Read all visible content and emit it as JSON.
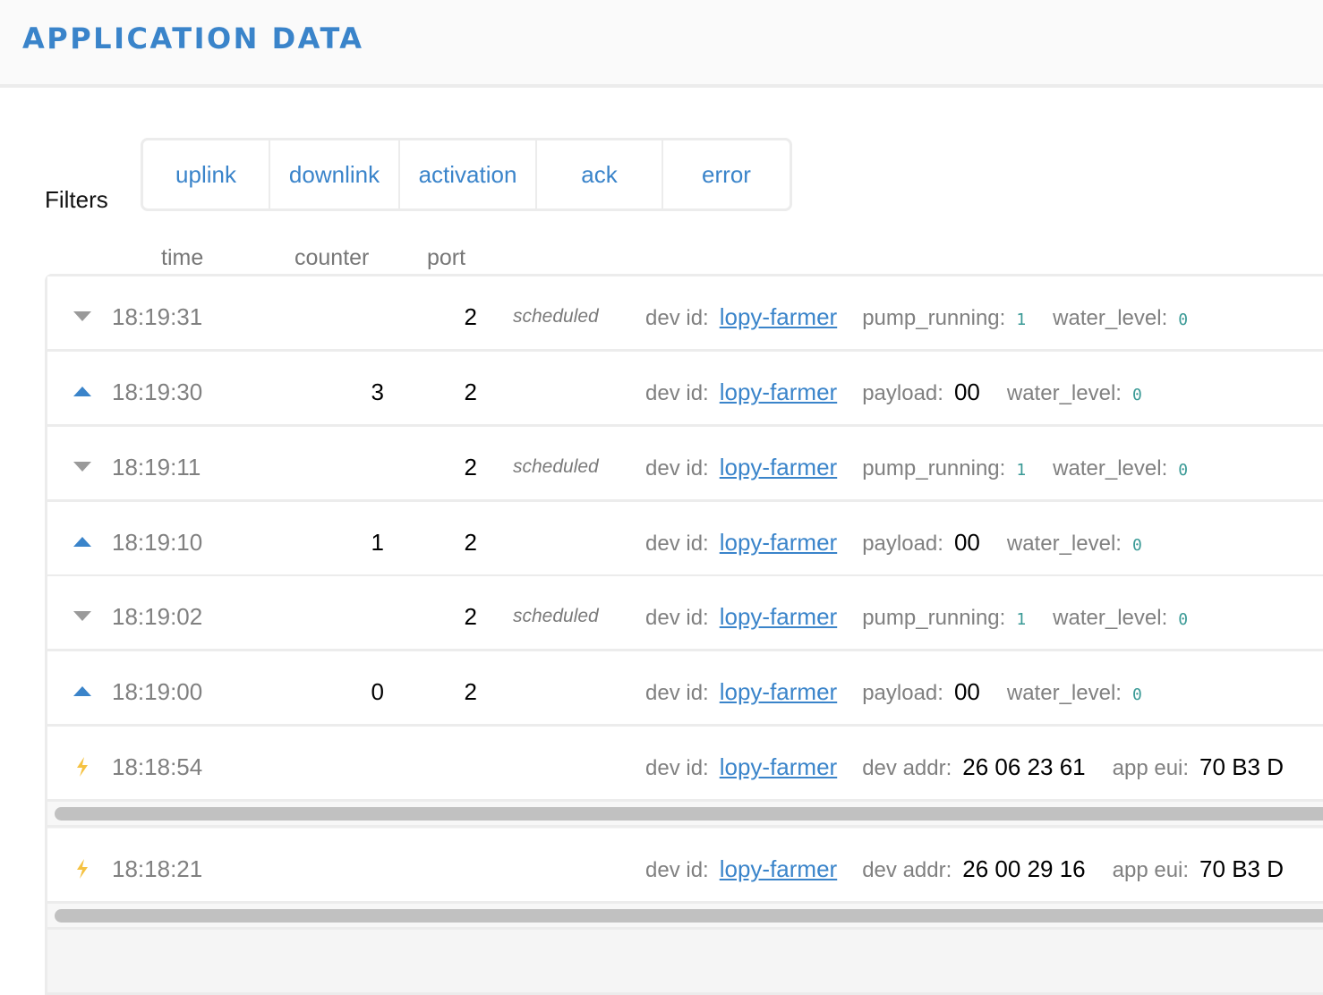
{
  "header": {
    "title": "APPLICATION DATA"
  },
  "filters": {
    "label": "Filters",
    "buttons": [
      {
        "label": "uplink"
      },
      {
        "label": "downlink"
      },
      {
        "label": "activation"
      },
      {
        "label": "ack"
      },
      {
        "label": "error"
      }
    ]
  },
  "columns": {
    "time": "time",
    "counter": "counter",
    "port": "port"
  },
  "colors": {
    "accent": "#3a84ca",
    "downlink_icon": "#9a9a9a",
    "activation_icon": "#f5c242",
    "field_value": "#3a9a96"
  },
  "rows": [
    {
      "type": "downlink",
      "icon": "triangle-down-icon",
      "time": "18:19:31",
      "counter": "",
      "port": "2",
      "status": "scheduled",
      "fields": [
        {
          "label": "dev id:",
          "value": "lopy-farmer",
          "kind": "link"
        },
        {
          "label": "pump_running:",
          "value": "1",
          "kind": "code"
        },
        {
          "label": "water_level:",
          "value": "0",
          "kind": "code"
        }
      ]
    },
    {
      "type": "uplink",
      "icon": "triangle-up-icon",
      "time": "18:19:30",
      "counter": "3",
      "port": "2",
      "status": "",
      "fields": [
        {
          "label": "dev id:",
          "value": "lopy-farmer",
          "kind": "link"
        },
        {
          "label": "payload:",
          "value": "00",
          "kind": "val"
        },
        {
          "label": "water_level:",
          "value": "0",
          "kind": "code"
        }
      ]
    },
    {
      "type": "downlink",
      "icon": "triangle-down-icon",
      "time": "18:19:11",
      "counter": "",
      "port": "2",
      "status": "scheduled",
      "fields": [
        {
          "label": "dev id:",
          "value": "lopy-farmer",
          "kind": "link"
        },
        {
          "label": "pump_running:",
          "value": "1",
          "kind": "code"
        },
        {
          "label": "water_level:",
          "value": "0",
          "kind": "code"
        }
      ]
    },
    {
      "type": "uplink",
      "icon": "triangle-up-icon",
      "time": "18:19:10",
      "counter": "1",
      "port": "2",
      "status": "",
      "fields": [
        {
          "label": "dev id:",
          "value": "lopy-farmer",
          "kind": "link"
        },
        {
          "label": "payload:",
          "value": "00",
          "kind": "val"
        },
        {
          "label": "water_level:",
          "value": "0",
          "kind": "code"
        }
      ]
    },
    {
      "type": "downlink",
      "icon": "triangle-down-icon",
      "time": "18:19:02",
      "counter": "",
      "port": "2",
      "status": "scheduled",
      "fields": [
        {
          "label": "dev id:",
          "value": "lopy-farmer",
          "kind": "link"
        },
        {
          "label": "pump_running:",
          "value": "1",
          "kind": "code"
        },
        {
          "label": "water_level:",
          "value": "0",
          "kind": "code"
        }
      ]
    },
    {
      "type": "uplink",
      "icon": "triangle-up-icon",
      "time": "18:19:00",
      "counter": "0",
      "port": "2",
      "status": "",
      "fields": [
        {
          "label": "dev id:",
          "value": "lopy-farmer",
          "kind": "link"
        },
        {
          "label": "payload:",
          "value": "00",
          "kind": "val"
        },
        {
          "label": "water_level:",
          "value": "0",
          "kind": "code"
        }
      ]
    },
    {
      "type": "activation",
      "icon": "lightning-icon",
      "time": "18:18:54",
      "counter": "",
      "port": "",
      "status": "",
      "fields": [
        {
          "label": "dev id:",
          "value": "lopy-farmer",
          "kind": "link"
        },
        {
          "label": "dev addr:",
          "value": "26 06 23 61",
          "kind": "val"
        },
        {
          "label": "app eui:",
          "value": "70 B3 D",
          "kind": "val"
        }
      ]
    },
    {
      "type": "activation",
      "icon": "lightning-icon",
      "time": "18:18:21",
      "counter": "",
      "port": "",
      "status": "",
      "fields": [
        {
          "label": "dev id:",
          "value": "lopy-farmer",
          "kind": "link"
        },
        {
          "label": "dev addr:",
          "value": "26 00 29 16",
          "kind": "val"
        },
        {
          "label": "app eui:",
          "value": "70 B3 D",
          "kind": "val"
        }
      ]
    }
  ]
}
